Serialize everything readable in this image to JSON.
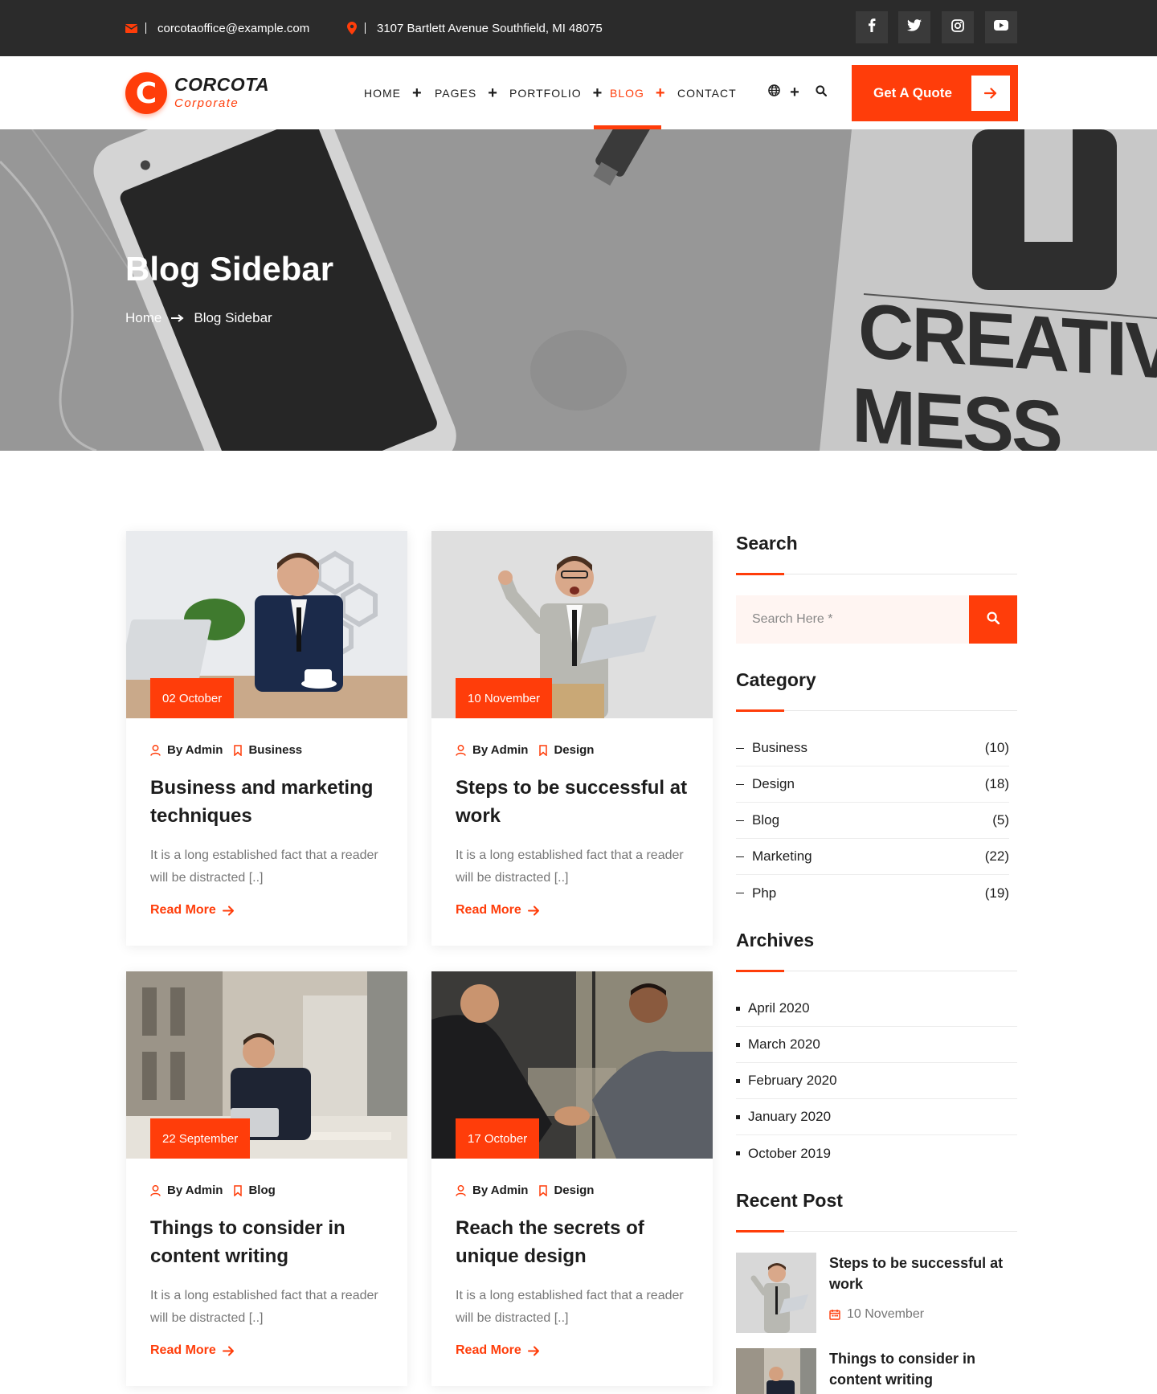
{
  "topbar": {
    "email": "corcotaoffice@example.com",
    "address": "3107 Bartlett Avenue Southfield, MI 48075",
    "social": [
      "facebook-icon",
      "twitter-icon",
      "instagram-icon",
      "youtube-icon"
    ]
  },
  "brand": {
    "name": "CORCOTA",
    "tagline": "Corporate",
    "mark": "C",
    "accent": "#ff3d0a",
    "dark": "#2b2b2b"
  },
  "nav": {
    "items": [
      {
        "label": "HOME",
        "has_submenu": true
      },
      {
        "label": "PAGES",
        "has_submenu": true
      },
      {
        "label": "PORTFOLIO",
        "has_submenu": true
      },
      {
        "label": "BLOG",
        "has_submenu": true,
        "active": true
      },
      {
        "label": "CONTACT",
        "has_submenu": false
      }
    ],
    "cta_label": "Get A Quote"
  },
  "hero": {
    "title": "Blog Sidebar",
    "breadcrumb": [
      "Home",
      "Blog Sidebar"
    ],
    "background_text_1": "CREATIVE",
    "background_text_2": "MESS"
  },
  "posts": [
    {
      "date": "02 October",
      "author": "By Admin",
      "category": "Business",
      "title": "Business and marketing techniques",
      "excerpt": "It is a long established fact that a reader will be distracted [..]",
      "read_more": "Read More"
    },
    {
      "date": "10 November",
      "author": "By Admin",
      "category": "Design",
      "title": "Steps to be successful at work",
      "excerpt": "It is a long established fact that a reader will be distracted [..]",
      "read_more": "Read More"
    },
    {
      "date": "22 September",
      "author": "By Admin",
      "category": "Blog",
      "title": "Things to consider in content writing",
      "excerpt": "It is a long established fact that a reader will be distracted [..]",
      "read_more": "Read More"
    },
    {
      "date": "17 October",
      "author": "By Admin",
      "category": "Design",
      "title": "Reach the secrets of unique design",
      "excerpt": "It is a long established fact that a reader will be distracted [..]",
      "read_more": "Read More"
    }
  ],
  "sidebar": {
    "search": {
      "title": "Search",
      "placeholder": "Search Here *"
    },
    "category": {
      "title": "Category",
      "items": [
        {
          "name": "Business",
          "count": "(10)"
        },
        {
          "name": "Design",
          "count": "(18)"
        },
        {
          "name": "Blog",
          "count": "(5)"
        },
        {
          "name": "Marketing",
          "count": "(22)"
        },
        {
          "name": "Php",
          "count": "(19)"
        }
      ]
    },
    "archives": {
      "title": "Archives",
      "items": [
        "April 2020",
        "March 2020",
        "February 2020",
        "January 2020",
        "October 2019"
      ]
    },
    "recent": {
      "title": "Recent Post",
      "items": [
        {
          "title": "Steps to be successful at work",
          "date": "10 November"
        },
        {
          "title": "Things to consider in content writing",
          "date": ""
        }
      ]
    }
  }
}
